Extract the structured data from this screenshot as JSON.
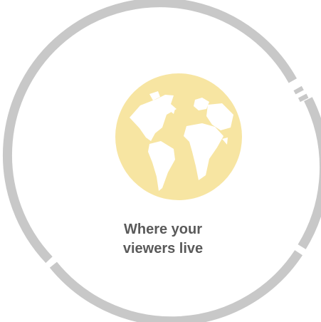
{
  "widget": {
    "label_line1": "Where your",
    "label_line2": "viewers live",
    "icon": "globe-icon"
  },
  "colors": {
    "ring": "#c8c8c8",
    "globe_fill": "#f7e5a2",
    "label_text": "#5a5a5a",
    "background": "#ffffff"
  }
}
